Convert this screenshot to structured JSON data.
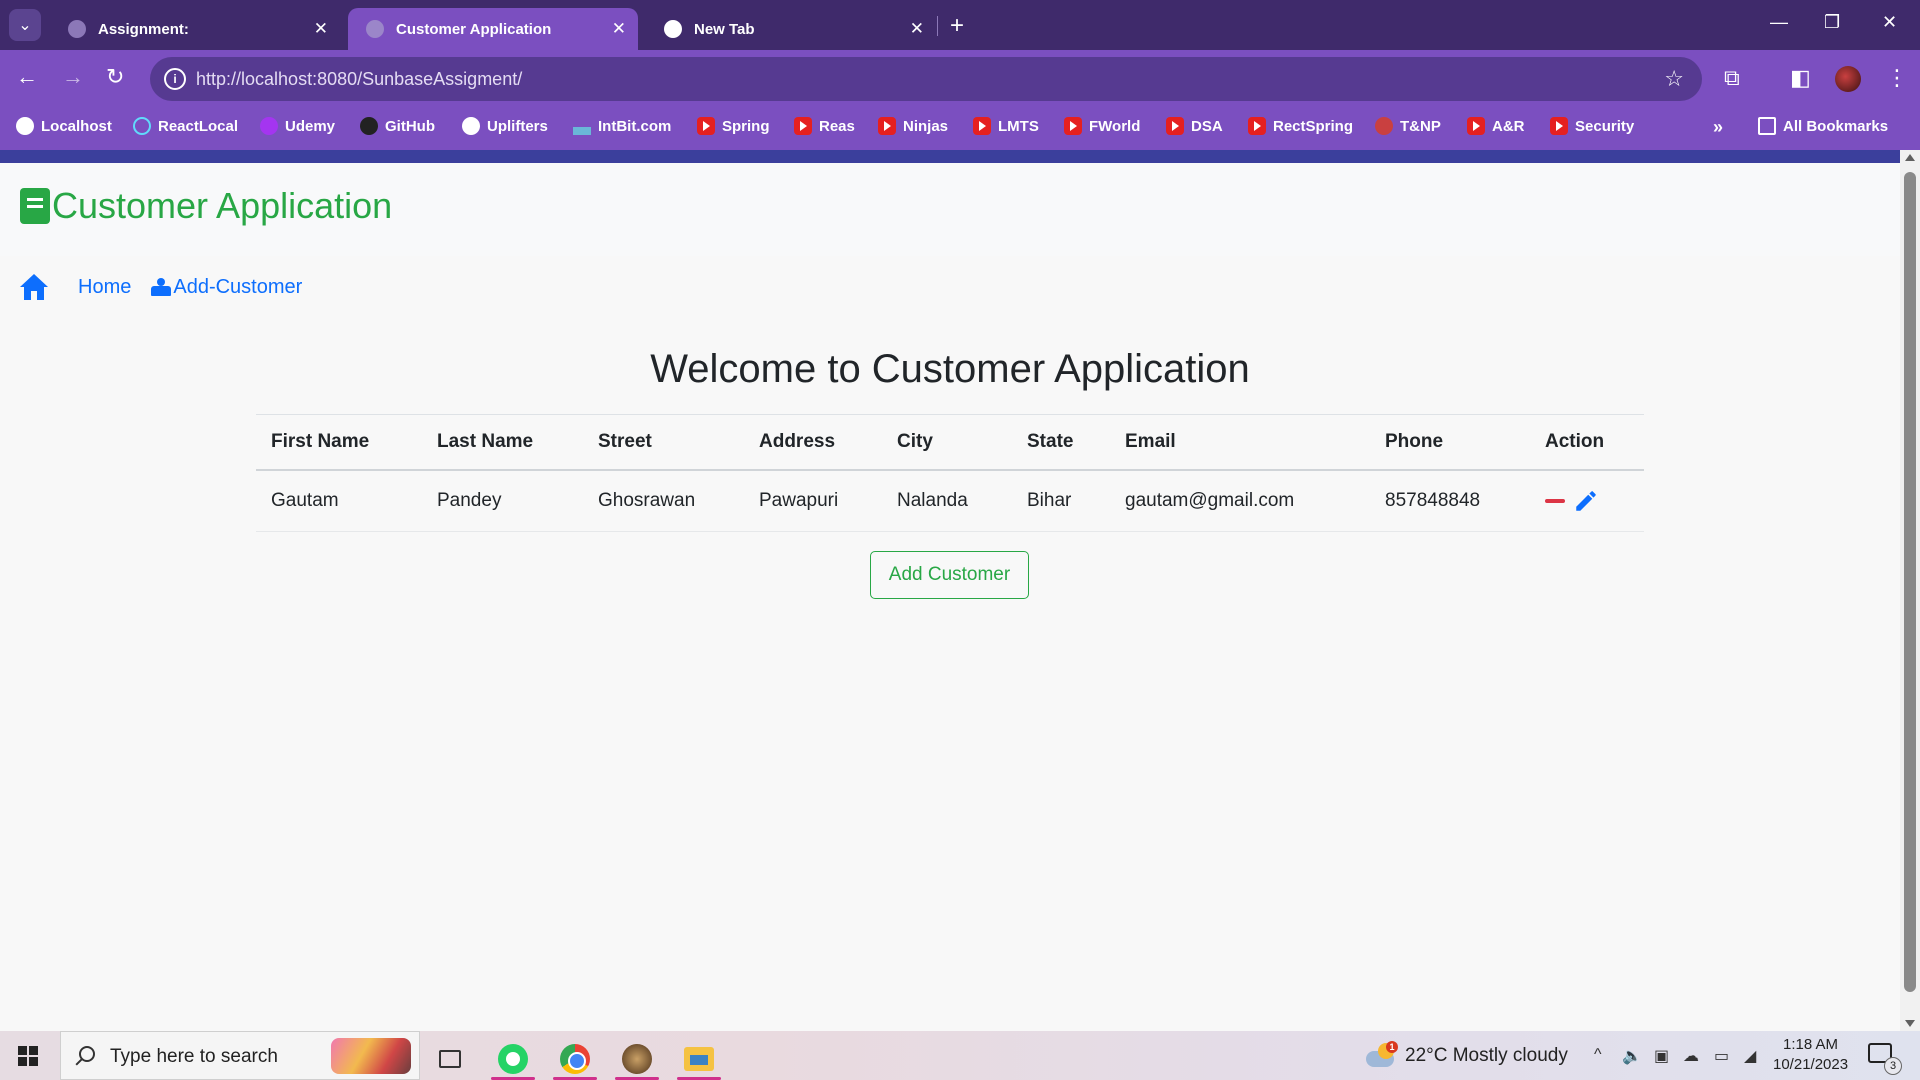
{
  "browser": {
    "tabs": [
      {
        "title": "Assignment:",
        "active": false
      },
      {
        "title": "Customer Application",
        "active": true
      },
      {
        "title": "New Tab",
        "active": false
      }
    ],
    "url": "http://localhost:8080/SunbaseAssigment/",
    "bookmarks": [
      "Localhost",
      "ReactLocal",
      "Udemy",
      "GitHub",
      "Uplifters",
      "IntBit.com",
      "Spring",
      "Reas",
      "Ninjas",
      "LMTS",
      "FWorld",
      "DSA",
      "RectSpring",
      "T&NP",
      "A&R",
      "Security"
    ],
    "all_bookmarks": "All Bookmarks",
    "accent_color": "#7b4fc0"
  },
  "app": {
    "brand": "Customer Application",
    "nav": {
      "home": "Home",
      "add_customer": "Add-Customer"
    },
    "heading": "Welcome to Customer Application",
    "table": {
      "headers": [
        "First Name",
        "Last Name",
        "Street",
        "Address",
        "City",
        "State",
        "Email",
        "Phone",
        "Action"
      ],
      "rows": [
        [
          "Gautam",
          "Pandey",
          "Ghosrawan",
          "Pawapuri",
          "Nalanda",
          "Bihar",
          "gautam@gmail.com",
          "857848848"
        ]
      ]
    },
    "add_button": "Add Customer",
    "colors": {
      "brand_green": "#28a745",
      "link_blue": "#0d6efd",
      "delete_red": "#dc3545"
    }
  },
  "taskbar": {
    "search_placeholder": "Type here to search",
    "weather": "22°C  Mostly cloudy",
    "weather_alert": "1",
    "time": "1:18 AM",
    "date": "10/21/2023",
    "notification_count": "3"
  }
}
